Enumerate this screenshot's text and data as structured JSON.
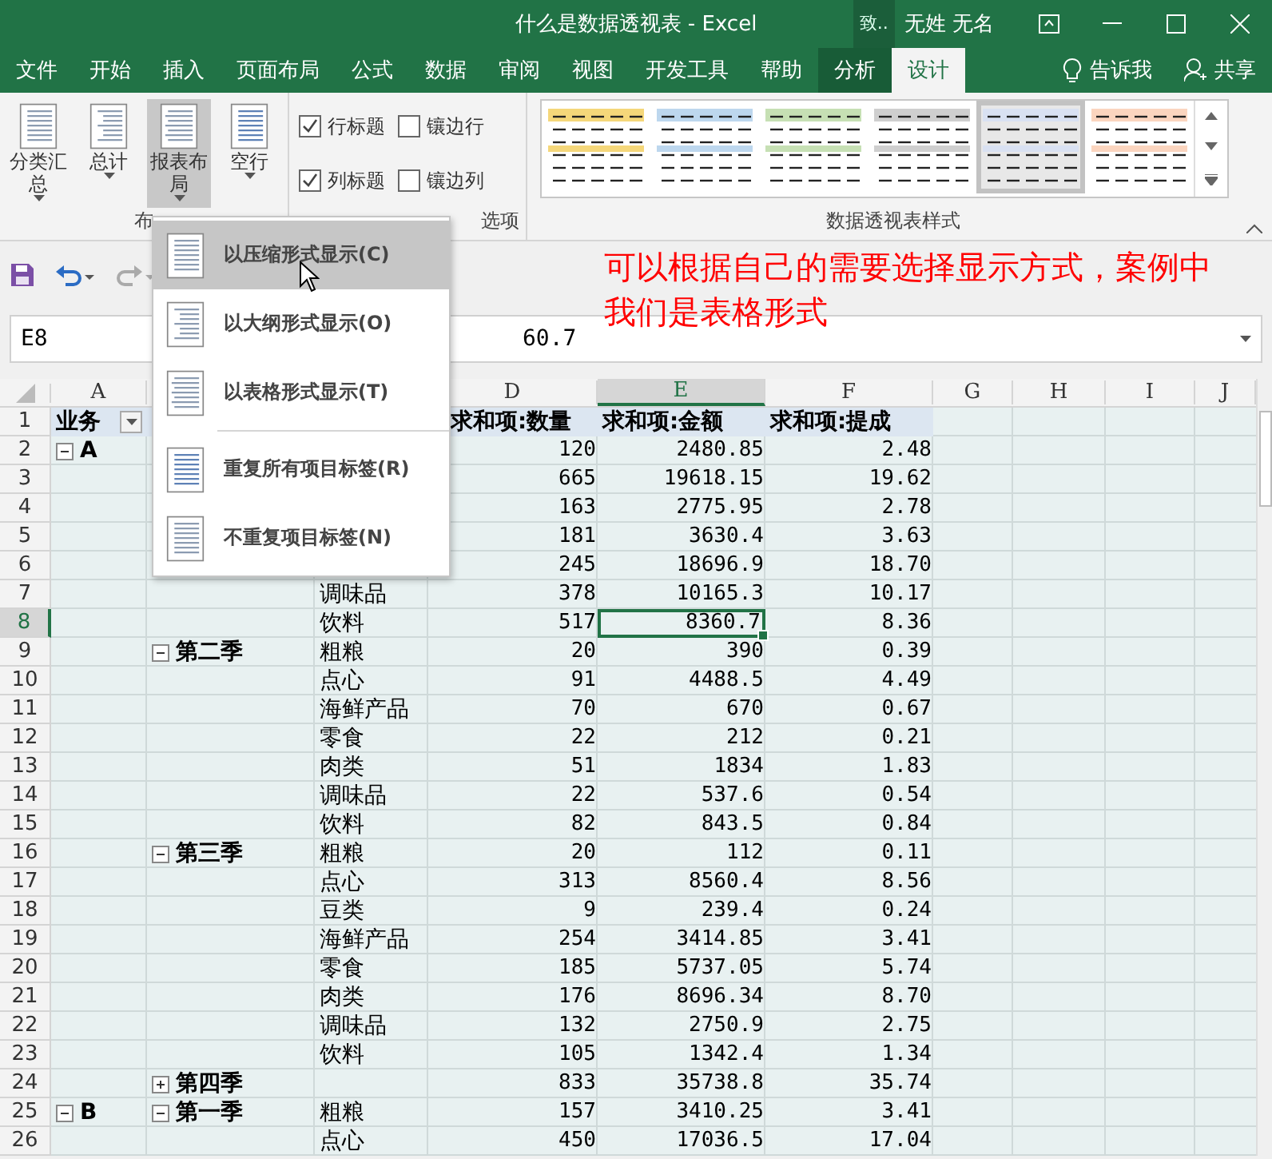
{
  "window": {
    "title": "什么是数据透视表 - Excel",
    "account_hint": "致..",
    "user": "无姓 无名"
  },
  "tabs": [
    {
      "label": "文件",
      "kind": "tab",
      "contextual": false,
      "selected": false
    },
    {
      "label": "开始",
      "kind": "tab",
      "contextual": false,
      "selected": false
    },
    {
      "label": "插入",
      "kind": "tab",
      "contextual": false,
      "selected": false
    },
    {
      "label": "页面布局",
      "kind": "tab",
      "contextual": false,
      "selected": false
    },
    {
      "label": "公式",
      "kind": "tab",
      "contextual": false,
      "selected": false
    },
    {
      "label": "数据",
      "kind": "tab",
      "contextual": false,
      "selected": false
    },
    {
      "label": "审阅",
      "kind": "tab",
      "contextual": false,
      "selected": false
    },
    {
      "label": "视图",
      "kind": "tab",
      "contextual": false,
      "selected": false
    },
    {
      "label": "开发工具",
      "kind": "tab",
      "contextual": false,
      "selected": false
    },
    {
      "label": "帮助",
      "kind": "tab",
      "contextual": false,
      "selected": false
    },
    {
      "label": "分析",
      "kind": "tab",
      "contextual": true,
      "selected": false
    },
    {
      "label": "设计",
      "kind": "tab",
      "contextual": true,
      "selected": true
    },
    {
      "label": "告诉我",
      "kind": "search",
      "contextual": false,
      "selected": false
    },
    {
      "label": "共享",
      "kind": "share",
      "contextual": false,
      "selected": false
    }
  ],
  "ribbon": {
    "layout_group": {
      "label": "布",
      "buttons": [
        {
          "label": "分类汇总",
          "pressed": false
        },
        {
          "label": "总计",
          "pressed": false
        },
        {
          "label": "报表布局",
          "pressed": true
        },
        {
          "label": "空行",
          "pressed": false
        }
      ]
    },
    "options_group": {
      "label": "选项",
      "options": [
        {
          "label": "行标题",
          "checked": true
        },
        {
          "label": "镶边行",
          "checked": false
        },
        {
          "label": "列标题",
          "checked": true
        },
        {
          "label": "镶边列",
          "checked": false
        }
      ]
    },
    "styles_group": {
      "label": "数据透视表样式",
      "styles": [
        {
          "color": "#f5d77a",
          "selected": false
        },
        {
          "color": "#bdd7ee",
          "selected": false
        },
        {
          "color": "#c6e0b4",
          "selected": false
        },
        {
          "color": "#cfcfcf",
          "selected": false
        },
        {
          "color": "#d9e1f2",
          "selected": true
        },
        {
          "color": "#fbd5bf",
          "selected": false
        }
      ]
    }
  },
  "annotation": "可以根据自己的需要选择显示方式，案例中我们是表格形式",
  "formula_bar": {
    "name_box": "E8",
    "value": "60.7"
  },
  "menu": {
    "sections": [
      [
        {
          "label": "以压缩形式显示(C)",
          "selected": true
        },
        {
          "label": "以大纲形式显示(O)",
          "selected": false
        },
        {
          "label": "以表格形式显示(T)",
          "selected": false
        }
      ],
      [
        {
          "label": "重复所有项目标签(R)",
          "selected": false
        },
        {
          "label": "不重复项目标签(N)",
          "selected": false
        }
      ]
    ]
  },
  "columns": [
    {
      "label": "A",
      "selected": false
    },
    {
      "label": "D",
      "selected": false
    },
    {
      "label": "E",
      "selected": true
    },
    {
      "label": "F",
      "selected": false
    },
    {
      "label": "G",
      "selected": false
    },
    {
      "label": "H",
      "selected": false
    },
    {
      "label": "I",
      "selected": false
    },
    {
      "label": "J",
      "selected": false
    }
  ],
  "header_row": {
    "n": "1",
    "a": "业务",
    "d": "求和项:数量",
    "e": "求和项:金额",
    "f": "求和项:提成"
  },
  "rows": [
    {
      "n": "2",
      "a": "A",
      "a_expanded": true,
      "d": "120",
      "e": "2480.85",
      "f": "2.48",
      "selected": false
    },
    {
      "n": "3",
      "d": "665",
      "e": "19618.15",
      "f": "19.62",
      "selected": false
    },
    {
      "n": "4",
      "d": "163",
      "e": "2775.95",
      "f": "2.78",
      "selected": false
    },
    {
      "n": "5",
      "d": "181",
      "e": "3630.4",
      "f": "3.63",
      "selected": false
    },
    {
      "n": "6",
      "d": "245",
      "e": "18696.9",
      "f": "18.70",
      "selected": false
    },
    {
      "n": "7",
      "c": "调味品",
      "d": "378",
      "e": "10165.3",
      "f": "10.17",
      "selected": false
    },
    {
      "n": "8",
      "c": "饮料",
      "d": "517",
      "e": "8360.7",
      "f": "8.36",
      "selected": true
    },
    {
      "n": "9",
      "b": "第二季",
      "b_expanded": true,
      "c": "粗粮",
      "d": "20",
      "e": "390",
      "f": "0.39",
      "selected": false
    },
    {
      "n": "10",
      "c": "点心",
      "d": "91",
      "e": "4488.5",
      "f": "4.49",
      "selected": false
    },
    {
      "n": "11",
      "c": "海鲜产品",
      "d": "70",
      "e": "670",
      "f": "0.67",
      "selected": false
    },
    {
      "n": "12",
      "c": "零食",
      "d": "22",
      "e": "212",
      "f": "0.21",
      "selected": false
    },
    {
      "n": "13",
      "c": "肉类",
      "d": "51",
      "e": "1834",
      "f": "1.83",
      "selected": false
    },
    {
      "n": "14",
      "c": "调味品",
      "d": "22",
      "e": "537.6",
      "f": "0.54",
      "selected": false
    },
    {
      "n": "15",
      "c": "饮料",
      "d": "82",
      "e": "843.5",
      "f": "0.84",
      "selected": false
    },
    {
      "n": "16",
      "b": "第三季",
      "b_expanded": true,
      "c": "粗粮",
      "d": "20",
      "e": "112",
      "f": "0.11",
      "selected": false
    },
    {
      "n": "17",
      "c": "点心",
      "d": "313",
      "e": "8560.4",
      "f": "8.56",
      "selected": false
    },
    {
      "n": "18",
      "c": "豆类",
      "d": "9",
      "e": "239.4",
      "f": "0.24",
      "selected": false
    },
    {
      "n": "19",
      "c": "海鲜产品",
      "d": "254",
      "e": "3414.85",
      "f": "3.41",
      "selected": false
    },
    {
      "n": "20",
      "c": "零食",
      "d": "185",
      "e": "5737.05",
      "f": "5.74",
      "selected": false
    },
    {
      "n": "21",
      "c": "肉类",
      "d": "176",
      "e": "8696.34",
      "f": "8.70",
      "selected": false
    },
    {
      "n": "22",
      "c": "调味品",
      "d": "132",
      "e": "2750.9",
      "f": "2.75",
      "selected": false
    },
    {
      "n": "23",
      "c": "饮料",
      "d": "105",
      "e": "1342.4",
      "f": "1.34",
      "selected": false
    },
    {
      "n": "24",
      "b": "第四季",
      "b_expanded": false,
      "d": "833",
      "e": "35738.8",
      "f": "35.74",
      "selected": false
    },
    {
      "n": "25",
      "a": "B",
      "a_expanded": true,
      "b": "第一季",
      "b_expanded": true,
      "c": "粗粮",
      "d": "157",
      "e": "3410.25",
      "f": "3.41",
      "selected": false
    },
    {
      "n": "26",
      "c": "点心",
      "d": "450",
      "e": "17036.5",
      "f": "17.04",
      "selected": false
    }
  ]
}
